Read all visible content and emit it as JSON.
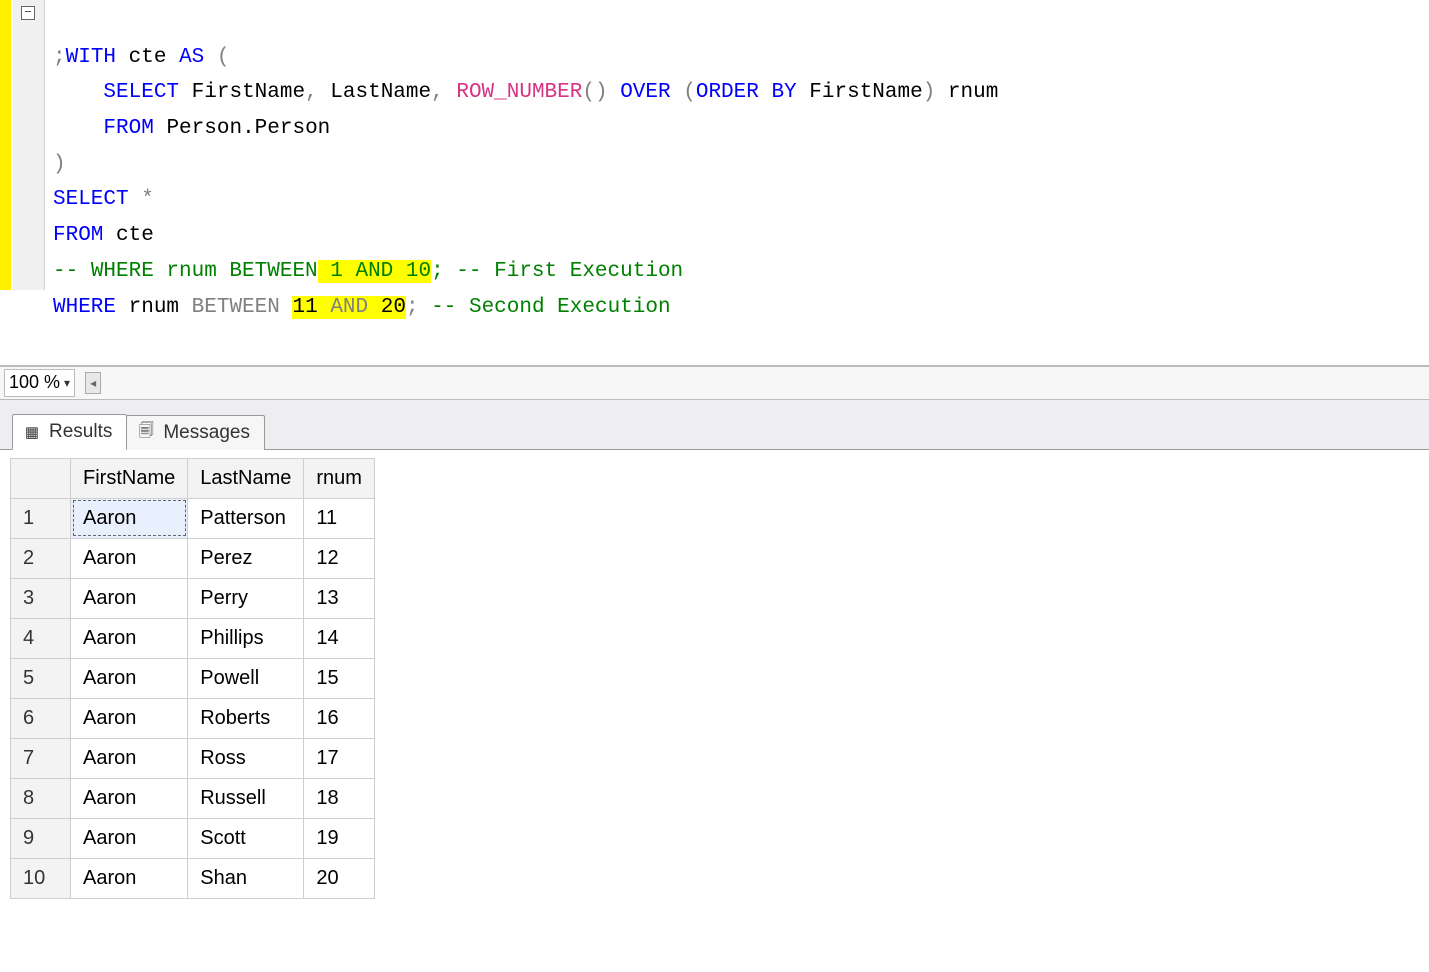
{
  "editor": {
    "line1": ";WITH cte AS (",
    "line2": "    SELECT FirstName, LastName, ROW_NUMBER() OVER (ORDER BY FirstName) rnum",
    "line3": "    FROM Person.Person",
    "line4": ")",
    "line5": "SELECT *",
    "line6": "FROM cte",
    "line7a": "-- WHERE rnum BETWEEN",
    "line7b_hl": " 1 AND 10",
    "line7c": "; -- First Execution",
    "line8a": "WHERE rnum BETWEEN ",
    "line8b_hl": "11 AND 20",
    "line8c": "; -- Second Execution"
  },
  "tokens": {
    "with": "WITH",
    "as": "AS",
    "select": "SELECT",
    "from": "FROM",
    "row_number": "ROW_NUMBER",
    "over": "OVER",
    "order_by": "ORDER BY",
    "where": "WHERE",
    "between": "BETWEEN",
    "and": "AND",
    "star": "*",
    "cte": "cte",
    "firstname": "FirstName",
    "lastname": "LastName",
    "rnum": "rnum",
    "person_person": "Person.Person",
    "semi": ";",
    "open_paren": "(",
    "close_paren": ")",
    "open_paren2": "()",
    "comment1_prefix": "-- ",
    "comment1_where": "WHERE rnum BETWEEN",
    "hl_1_10_pre": " 1 ",
    "hl_1_10_and": "AND",
    "hl_1_10_post": " 10",
    "post_semi_1": ";",
    "comment1_rest": " -- First Execution",
    "num_11": "11",
    "num_20": "20",
    "comment2": " -- Second Execution"
  },
  "zoom": {
    "value": "100 %"
  },
  "tabs": {
    "results": "Results",
    "messages": "Messages"
  },
  "results": {
    "columns": [
      "FirstName",
      "LastName",
      "rnum"
    ],
    "rows": [
      {
        "n": "1",
        "FirstName": "Aaron",
        "LastName": "Patterson",
        "rnum": "11"
      },
      {
        "n": "2",
        "FirstName": "Aaron",
        "LastName": "Perez",
        "rnum": "12"
      },
      {
        "n": "3",
        "FirstName": "Aaron",
        "LastName": "Perry",
        "rnum": "13"
      },
      {
        "n": "4",
        "FirstName": "Aaron",
        "LastName": "Phillips",
        "rnum": "14"
      },
      {
        "n": "5",
        "FirstName": "Aaron",
        "LastName": "Powell",
        "rnum": "15"
      },
      {
        "n": "6",
        "FirstName": "Aaron",
        "LastName": "Roberts",
        "rnum": "16"
      },
      {
        "n": "7",
        "FirstName": "Aaron",
        "LastName": "Ross",
        "rnum": "17"
      },
      {
        "n": "8",
        "FirstName": "Aaron",
        "LastName": "Russell",
        "rnum": "18"
      },
      {
        "n": "9",
        "FirstName": "Aaron",
        "LastName": "Scott",
        "rnum": "19"
      },
      {
        "n": "10",
        "FirstName": "Aaron",
        "LastName": "Shan",
        "rnum": "20"
      }
    ]
  }
}
